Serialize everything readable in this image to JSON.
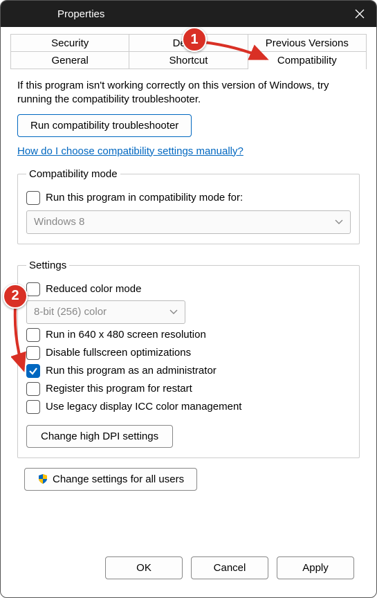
{
  "window": {
    "title": "Properties"
  },
  "tabs": {
    "row1": [
      "Security",
      "Details",
      "Previous Versions"
    ],
    "row2": [
      "General",
      "Shortcut",
      "Compatibility"
    ],
    "active": "Compatibility"
  },
  "intro": "If this program isn't working correctly on this version of Windows, try running the compatibility troubleshooter.",
  "buttons": {
    "troubleshoot": "Run compatibility troubleshooter",
    "dpi": "Change high DPI settings",
    "allusers": "Change settings for all users",
    "ok": "OK",
    "cancel": "Cancel",
    "apply": "Apply"
  },
  "link": "How do I choose compatibility settings manually?",
  "groups": {
    "compat": {
      "legend": "Compatibility mode",
      "checkbox": "Run this program in compatibility mode for:",
      "select": "Windows 8"
    },
    "settings": {
      "legend": "Settings",
      "reduced_color": "Reduced color mode",
      "color_select": "8-bit (256) color",
      "run640": "Run in 640 x 480 screen resolution",
      "disable_fs": "Disable fullscreen optimizations",
      "run_admin": "Run this program as an administrator",
      "register_restart": "Register this program for restart",
      "legacy_icc": "Use legacy display ICC color management"
    }
  },
  "checked": {
    "run_admin": true
  },
  "annotations": {
    "1": "1",
    "2": "2"
  }
}
